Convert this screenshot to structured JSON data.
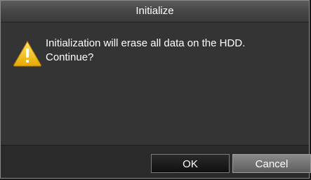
{
  "dialog": {
    "title": "Initialize",
    "message_line1": "Initialization will erase all data on the HDD.",
    "message_line2": "Continue?",
    "icon": "warning-icon",
    "ok_label": "OK",
    "cancel_label": "Cancel"
  },
  "colors": {
    "warning_fill": "#f5c400",
    "warning_mark": "#ffffff",
    "dialog_bg": "#343434",
    "footer_bg": "#2a2a2a",
    "text": "#ffffff"
  }
}
